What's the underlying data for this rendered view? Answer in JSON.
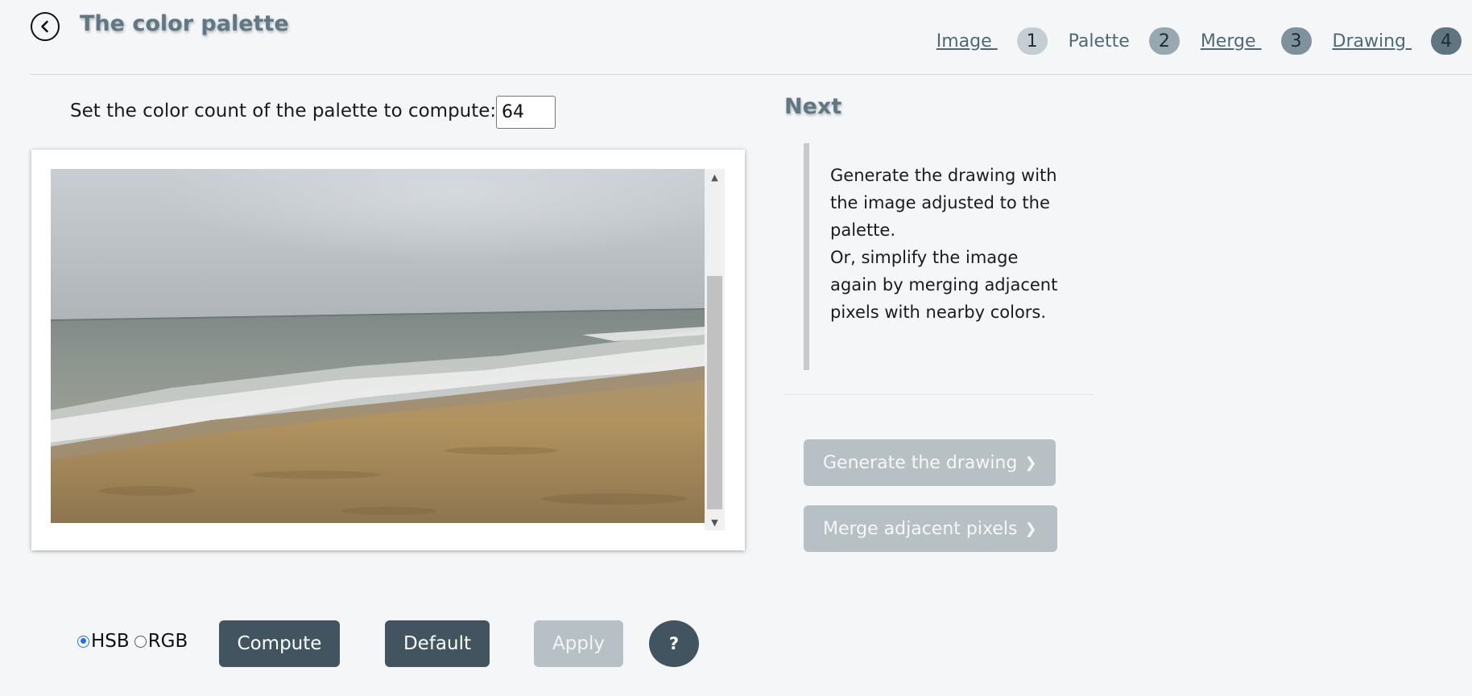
{
  "header": {
    "title": "The color palette",
    "steps": [
      {
        "label": "Image",
        "number": "1",
        "link": true,
        "badge_color": "#c4ced3"
      },
      {
        "label": "Palette",
        "number": "2",
        "link": false,
        "badge_color": "#98a8b0"
      },
      {
        "label": "Merge",
        "number": "3",
        "link": true,
        "badge_color": "#7d929c"
      },
      {
        "label": "Drawing",
        "number": "4",
        "link": true,
        "badge_color": "#5f7681"
      }
    ]
  },
  "palette": {
    "count_label": "Set the color count of the palette to compute:",
    "count_value": "64"
  },
  "next": {
    "title": "Next",
    "description_lines": [
      "Generate the drawing with the image adjusted to the palette.",
      "Or, simplify the image again by merging adjacent pixels with nearby colors."
    ],
    "generate_label": "Generate the drawing",
    "merge_label": "Merge adjacent pixels",
    "chevron": "❯"
  },
  "controls": {
    "mode_options": [
      "HSB",
      "RGB"
    ],
    "mode_selected": "HSB",
    "compute_label": "Compute",
    "default_label": "Default",
    "apply_label": "Apply",
    "help_label": "?"
  },
  "colors": {
    "accent": "#415460",
    "disabled": "#b7c0c5",
    "title": "#5f7884",
    "background": "#f4f6f8"
  },
  "icons": {
    "back": "chevron-left-circle-icon",
    "scroll_up": "triangle-up-icon",
    "scroll_down": "triangle-down-icon"
  }
}
